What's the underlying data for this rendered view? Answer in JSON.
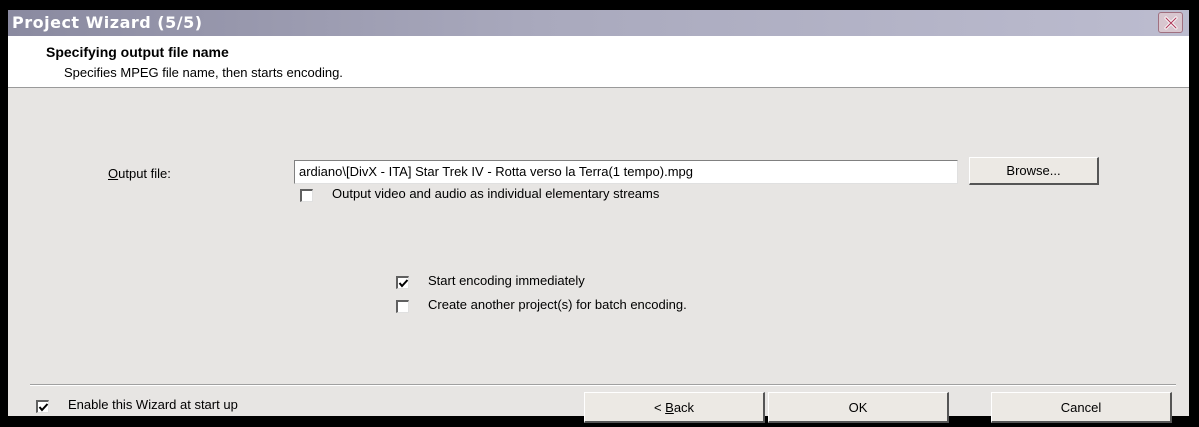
{
  "window": {
    "title": "Project Wizard (5/5)"
  },
  "header": {
    "title": "Specifying output file name",
    "subtitle": "Specifies MPEG file name, then starts encoding."
  },
  "output": {
    "label_accel": "O",
    "label_rest": "utput file:",
    "value": "ardiano\\[DivX - ITA] Star Trek IV - Rotta verso la Terra(1 tempo).mpg",
    "browse_label": "Browse...",
    "elementary_streams_label": "Output video and audio as individual elementary streams",
    "elementary_streams_checked": false
  },
  "options": {
    "start_encoding_label": "Start encoding immediately",
    "start_encoding_checked": true,
    "batch_label": "Create another project(s) for batch encoding.",
    "batch_checked": false
  },
  "footer": {
    "enable_wizard_label": "Enable this Wizard at start up",
    "enable_wizard_checked": true,
    "back_prefix": "< ",
    "back_accel": "B",
    "back_rest": "ack",
    "ok_label": "OK",
    "cancel_label": "Cancel"
  }
}
